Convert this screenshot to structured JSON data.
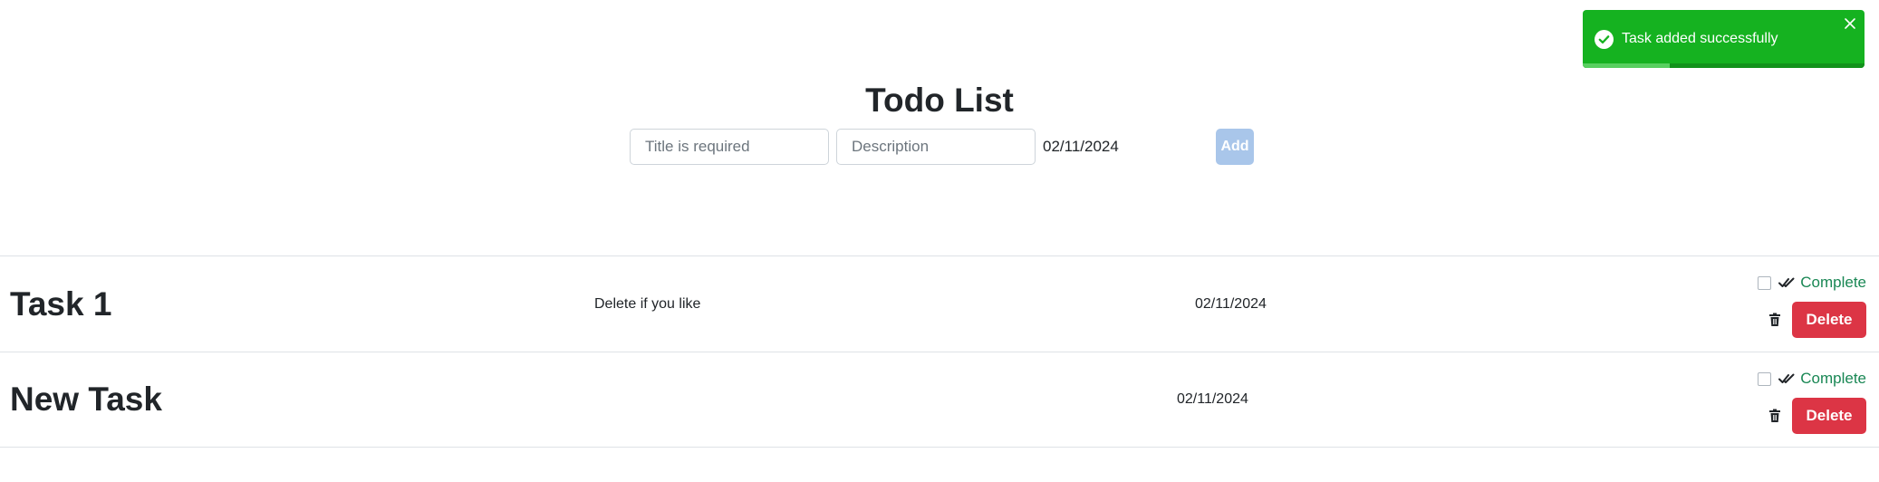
{
  "header": {
    "title": "Todo List"
  },
  "form": {
    "title_placeholder": "Title is required",
    "description_placeholder": "Description",
    "date_value": "02/11/2024",
    "add_label": "Add"
  },
  "tasks": [
    {
      "title": "Task 1",
      "description": "Delete if you like",
      "date": "02/11/2024",
      "complete_label": "Complete",
      "delete_label": "Delete",
      "completed": false
    },
    {
      "title": "New Task",
      "description": "",
      "date": "02/11/2024",
      "complete_label": "Complete",
      "delete_label": "Delete",
      "completed": false
    }
  ],
  "toast": {
    "message": "Task added successfully",
    "progress_remaining": 0.31,
    "icon": "check-circle-icon"
  },
  "colors": {
    "accent_green": "#15b220",
    "danger_red": "#dc3545",
    "complete_green": "#198754",
    "add_disabled": "#a9c6ea"
  }
}
